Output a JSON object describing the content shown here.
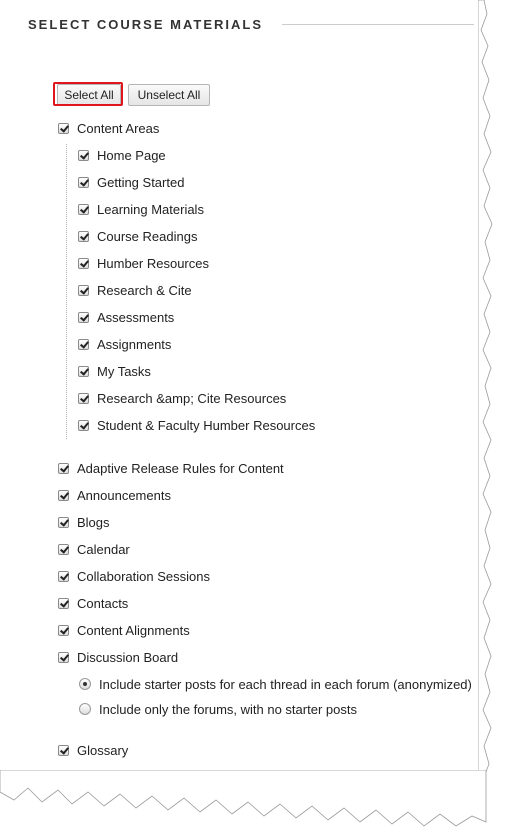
{
  "heading": "SELECT COURSE MATERIALS",
  "buttons": {
    "select_all": "Select All",
    "unselect_all": "Unselect All"
  },
  "content_areas": {
    "label": "Content Areas",
    "children": [
      "Home Page",
      "Getting Started",
      "Learning Materials",
      "Course Readings",
      "Humber Resources",
      "Research & Cite",
      "Assessments",
      "Assignments",
      "My Tasks",
      "Research &amp; Cite Resources",
      "Student & Faculty Humber Resources"
    ]
  },
  "items": [
    "Adaptive Release Rules for Content",
    "Announcements",
    "Blogs",
    "Calendar",
    "Collaboration Sessions",
    "Contacts",
    "Content Alignments",
    "Discussion Board"
  ],
  "discussion_options": [
    "Include starter posts for each thread in each forum (anonymized)",
    "Include only the forums, with no starter posts"
  ],
  "glossary": "Glossary",
  "colors": {
    "highlight": "#e0161d",
    "text": "#222222",
    "heading": "#333333"
  }
}
